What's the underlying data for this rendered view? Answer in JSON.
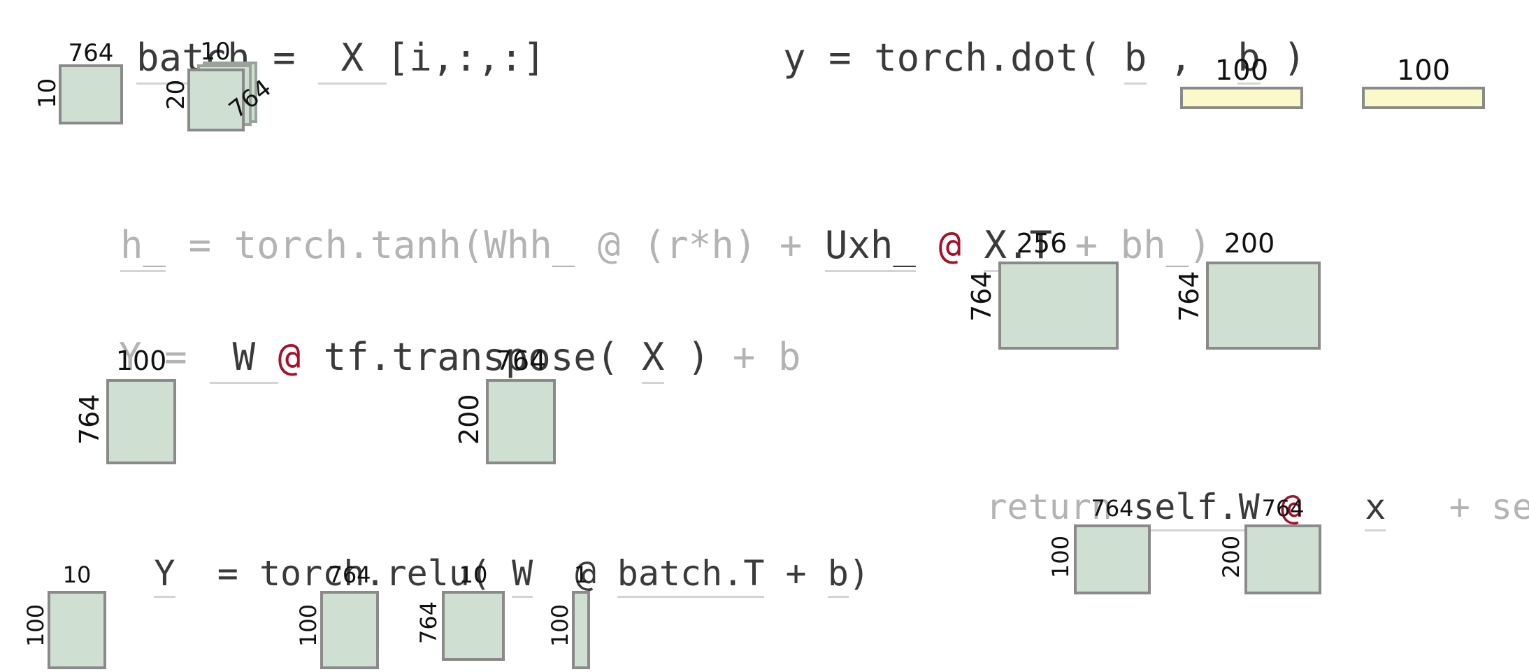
{
  "palette": {
    "matrix_fill": "#cfe0d3",
    "vector_fill": "#fbf8c9",
    "matrix_border": "#8a8a8a",
    "text_dim": "#b3b3b3",
    "text_hot": "#3a3a3a",
    "matmul_op": "#a4122c",
    "background": "#ffffff"
  },
  "lines": {
    "batch": {
      "t1": "batch",
      "t2": " = ",
      "t3": " X ",
      "t4": "[i,:,:]"
    },
    "dot": {
      "t1": "y = torch.dot( ",
      "t2": "b",
      "t3": " ,  ",
      "t4": "b",
      "t5": " )"
    },
    "tanh": {
      "t1": "h_",
      "t2": " = torch.tanh(Whh_ @ (r*h) + ",
      "t3": "Uxh_",
      "t4": " ",
      "t5": "@",
      "t6": " ",
      "t7": "X.T",
      "t8": " + bh_)"
    },
    "transpose": {
      "t1": "Y = ",
      "t2": " W ",
      "t3": "@",
      "t4": " tf.transpose( ",
      "t5": "X",
      "t6": " )",
      "t7": " + b"
    },
    "selfw": {
      "t1": "return ",
      "t2": "self.W",
      "t3": " ",
      "t4": "@",
      "t5": "   ",
      "t6": "x",
      "t7": "   + self.b"
    },
    "relu": {
      "t1": "Y",
      "t2": "  = torch.relu( ",
      "t3": "W",
      "t4": "  ",
      "t5": "@",
      "t6": " ",
      "t7": "batch.T",
      "t8": " + ",
      "t9": "b",
      "t10": ")"
    }
  },
  "shapes": {
    "batch_out": {
      "rows": "10",
      "cols": "764"
    },
    "x_tensor": {
      "rows": "20",
      "cols": "10",
      "depth": "764"
    },
    "dot_b1": {
      "cols": "100"
    },
    "dot_b2": {
      "cols": "100"
    },
    "uxh": {
      "rows": "764",
      "cols": "256"
    },
    "xt": {
      "rows": "764",
      "cols": "200"
    },
    "w_tf": {
      "rows": "764",
      "cols": "100"
    },
    "x_tf": {
      "rows": "200",
      "cols": "764"
    },
    "self_w": {
      "rows": "100",
      "cols": "764"
    },
    "self_x": {
      "rows": "200",
      "cols": "764"
    },
    "relu_y": {
      "rows": "100",
      "cols": "10"
    },
    "relu_w": {
      "rows": "100",
      "cols": "764"
    },
    "relu_batch": {
      "rows": "764",
      "cols": "10"
    },
    "relu_b": {
      "rows": "100",
      "cols": "1"
    }
  }
}
